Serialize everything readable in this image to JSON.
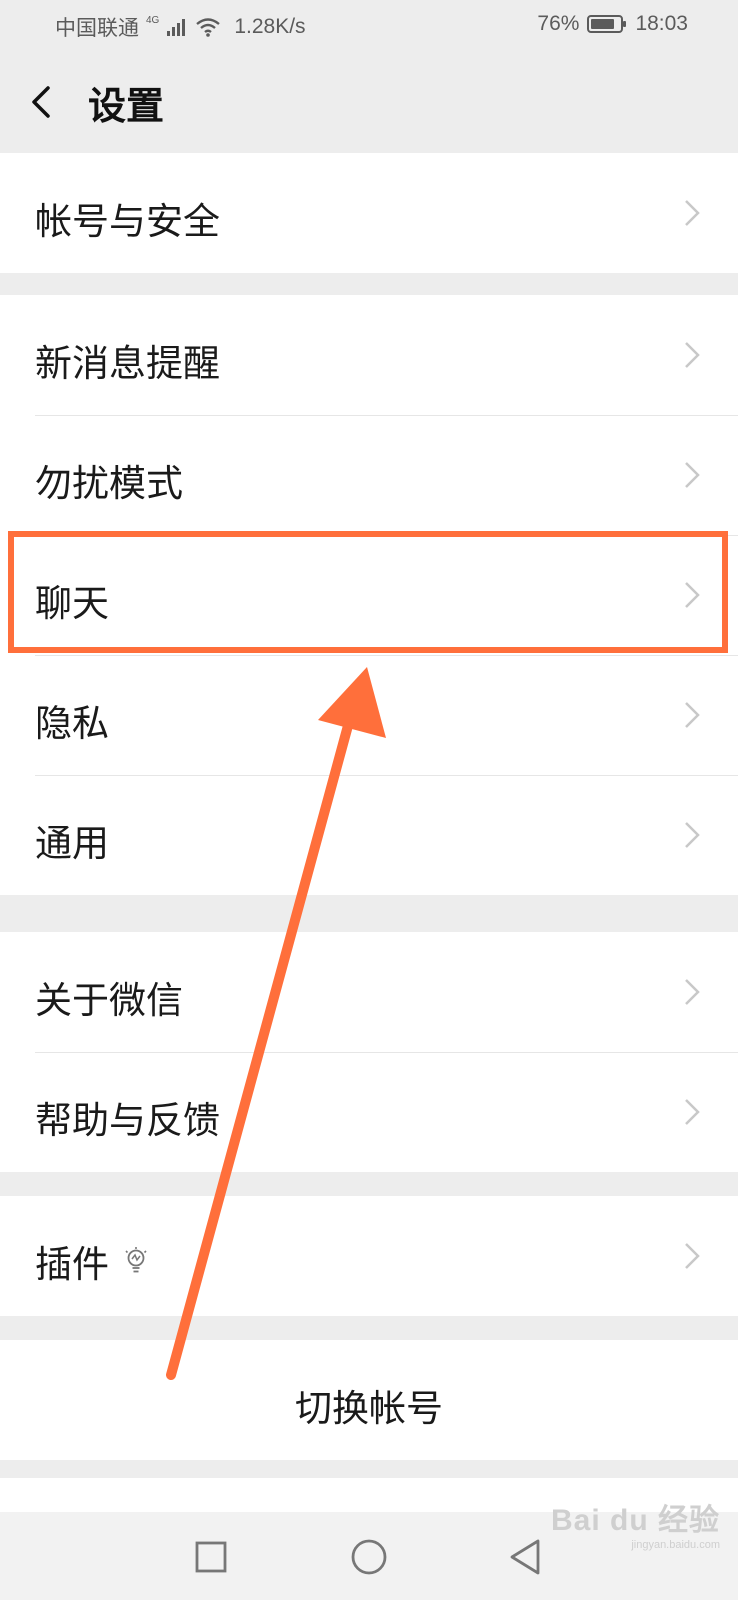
{
  "status_bar": {
    "carrier": "中国联通",
    "network_tag": "4G",
    "speed": "1.28K/s",
    "battery": "76%",
    "time": "18:03"
  },
  "header": {
    "title": "设置"
  },
  "groups": [
    {
      "items": [
        {
          "label": "帐号与安全"
        }
      ]
    },
    {
      "items": [
        {
          "label": "新消息提醒"
        },
        {
          "label": "勿扰模式"
        },
        {
          "label": "聊天"
        },
        {
          "label": "隐私"
        },
        {
          "label": "通用"
        }
      ]
    },
    {
      "items": [
        {
          "label": "关于微信"
        },
        {
          "label": "帮助与反馈"
        }
      ]
    },
    {
      "items": [
        {
          "label": "插件"
        }
      ]
    }
  ],
  "switch_account": {
    "label": "切换帐号"
  },
  "icons": [
    "back-icon",
    "chevron-right-icon",
    "lightbulb-icon",
    "square-nav-icon",
    "circle-nav-icon",
    "triangle-back-nav-icon"
  ],
  "highlight_color": "#ff6f3b",
  "watermark": {
    "brand": "Bai du 经验",
    "url": "jingyan.baidu.com"
  }
}
